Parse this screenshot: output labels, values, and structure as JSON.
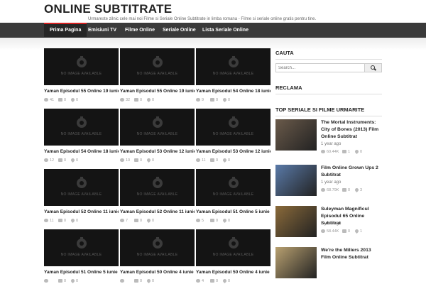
{
  "header": {
    "title": "ONLINE SUBTITRATE",
    "tagline": "Urmareste zilnic cele mai noi Filme si Seriale Online Subtitrate in limba romana - Filme si seriale online gratis pentru tine."
  },
  "nav": {
    "items": [
      {
        "label": "Prima Pagina"
      },
      {
        "label": "Emisiuni TV"
      },
      {
        "label": "Filme Online"
      },
      {
        "label": "Seriale Online"
      },
      {
        "label": "Lista Seriale Online"
      }
    ]
  },
  "placeholder_text": "NO IMAGE AVAILABLE",
  "posts": [
    {
      "title": "Yaman Episodul 55 Online 19 iunie",
      "views": "41",
      "comments": "0",
      "likes": "0"
    },
    {
      "title": "Yaman Episodul 55 Online 19 iunie",
      "views": "32",
      "comments": "0",
      "likes": "0"
    },
    {
      "title": "Yaman Episodul 54 Online 18 iunie",
      "views": "9",
      "comments": "0",
      "likes": "0"
    },
    {
      "title": "Yaman Episodul 54 Online 18 iunie",
      "views": "12",
      "comments": "0",
      "likes": "0"
    },
    {
      "title": "Yaman Episodul 53 Online 12 iunie",
      "views": "10",
      "comments": "0",
      "likes": "0"
    },
    {
      "title": "Yaman Episodul 53 Online 12 iunie",
      "views": "11",
      "comments": "0",
      "likes": "0"
    },
    {
      "title": "Yaman Episodul 52 Online 11 iunie",
      "views": "11",
      "comments": "0",
      "likes": "0"
    },
    {
      "title": "Yaman Episodul 52 Online 11 iunie",
      "views": "7",
      "comments": "0",
      "likes": "0"
    },
    {
      "title": "Yaman Episodul 51 Online 5 iunie",
      "views": "5",
      "comments": "0",
      "likes": "0"
    },
    {
      "title": "Yaman Episodul 51 Online 5 iunie",
      "views": "",
      "comments": "0",
      "likes": "0"
    },
    {
      "title": "Yaman Episodul 50 Online 4 iunie",
      "views": "",
      "comments": "0",
      "likes": "0"
    },
    {
      "title": "Yaman Episodul 50 Online 4 iunie",
      "views": "4",
      "comments": "0",
      "likes": "0"
    }
  ],
  "sidebar": {
    "search_heading": "CAUTA",
    "search_placeholder": "Search...",
    "ad_heading": "RECLAMA",
    "top_heading": "TOP SERIALE SI FILME URMARITE",
    "top_items": [
      {
        "title": "The Mortal Instruments: City of Bones (2013) Film Online Subtitrat",
        "date": "1 year ago",
        "views": "60.44K",
        "comments": "1",
        "likes": "0",
        "thumb_color": "#6a5a4a"
      },
      {
        "title": "Film Online Grown Ups 2 Subtitrat",
        "date": "1 year ago",
        "views": "68.79K",
        "comments": "0",
        "likes": "3",
        "thumb_color": "#5a7aa8"
      },
      {
        "title": "Suleyman Magnificul Episodul 65 Online Subtitrat",
        "date": "1 year ago",
        "views": "58.44K",
        "comments": "0",
        "likes": "1",
        "thumb_color": "#8a6a3a"
      },
      {
        "title": "We're the Millers 2013 Film Online Subtitrat",
        "date": "",
        "views": "",
        "comments": "",
        "likes": "",
        "thumb_color": "#b8a070"
      }
    ]
  },
  "colors": {
    "navbar": "#3a3a3a",
    "active_accent": "#d42020",
    "thumb_bg": "#141414"
  }
}
